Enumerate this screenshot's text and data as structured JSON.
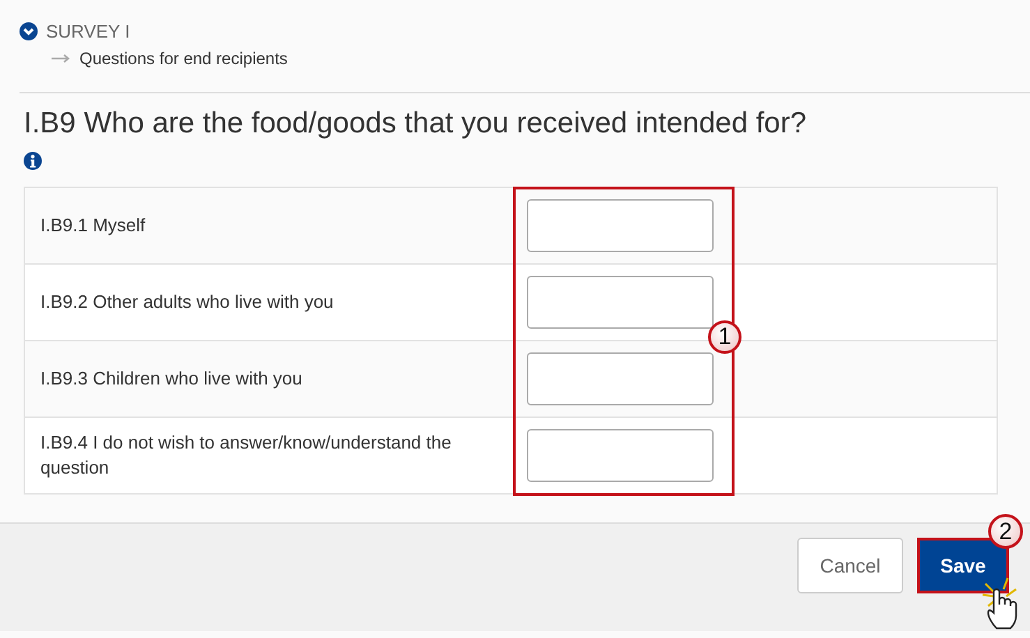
{
  "breadcrumb": {
    "section": "SURVEY I",
    "subsection": "Questions for end recipients",
    "expanded": true
  },
  "question": {
    "title": "I.B9 Who are the food/goods that you received intended for?"
  },
  "table": {
    "rows": [
      {
        "label": "I.B9.1 Myself"
      },
      {
        "label": "I.B9.2 Other adults who live with you"
      },
      {
        "label": "I.B9.3 Children who live with you"
      },
      {
        "label": "I.B9.4 I do not wish to answer/know/understand the question"
      }
    ],
    "callout": "1"
  },
  "footer": {
    "buttons": [
      {
        "label": "Cancel",
        "kind": "secondary"
      },
      {
        "label": "Save",
        "kind": "primary",
        "callout": "2"
      }
    ]
  }
}
